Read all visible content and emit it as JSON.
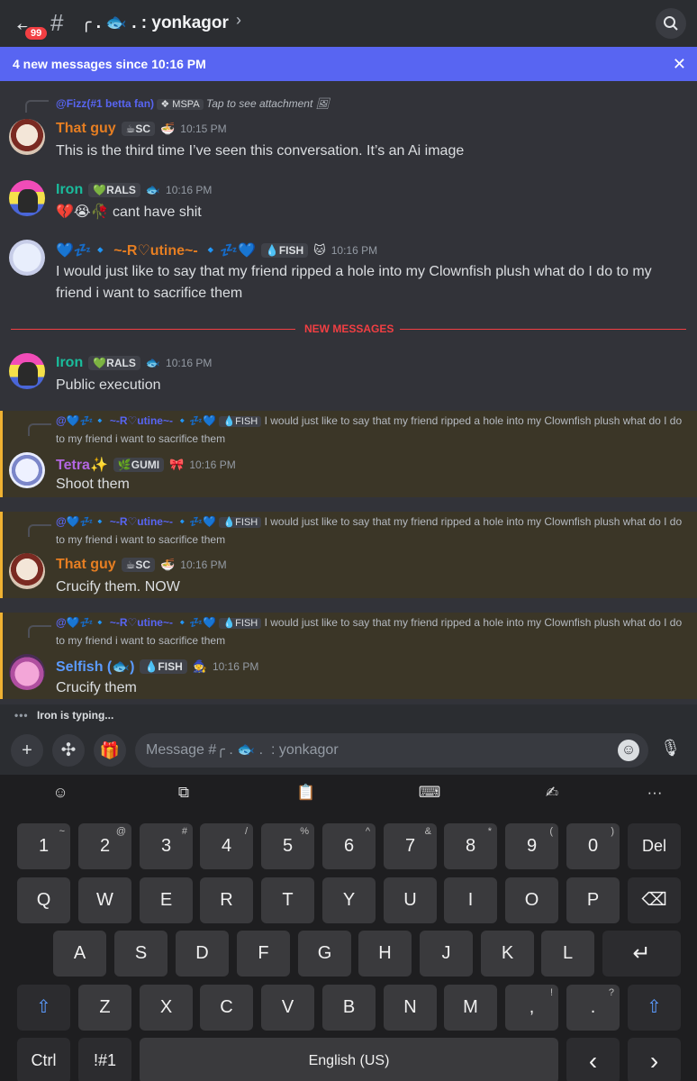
{
  "header": {
    "back_icon": "back-arrow-icon",
    "unread_badge": "99",
    "hash_symbol": "#",
    "channel_name": "╭ . 🐟 .  : yonkagor",
    "chevron": "›"
  },
  "banner": {
    "text": "4 new messages since 10:16 PM",
    "close": "✕"
  },
  "messages": [
    {
      "reply": {
        "name": "@Fizz(#1 betta fan)",
        "tag": "❖ MSPA",
        "text": "Tap to see attachment 🖼"
      },
      "author": "That guy",
      "author_color": "#e67e22",
      "tag": "☕SC",
      "deco": "🍜",
      "time": "10:15 PM",
      "content": "This is the third time I’ve seen this conversation. It’s an Ai image"
    },
    {
      "author": "Iron",
      "author_color": "#1abc9c",
      "tag": "💚RALS",
      "deco": "🐟",
      "time": "10:16 PM",
      "content": "💔😭🥀  cant have shit"
    },
    {
      "author": "💙💤🔹 ~-R♡utine~- 🔹💤💙",
      "author_color": "#e67e22",
      "tag": "💧FISH",
      "deco": "🐱",
      "time": "10:16 PM",
      "content": "I would just like to say that my friend ripped a hole into my Clownfish plush what do I do to my friend i want to sacrifice them"
    },
    {
      "author": "Iron",
      "author_color": "#1abc9c",
      "tag": "💚RALS",
      "deco": "🐟",
      "time": "10:16 PM",
      "content": "Public execution"
    },
    {
      "reply": {
        "name": "@💙💤🔹 ~-R♡utine~- 🔹💤💙",
        "tag": "💧FISH",
        "text": "I would just like to say that my friend ripped a hole into my Clownfish plush what do I do to my friend i want to sacrifice them"
      },
      "author": "Tetra✨",
      "author_color": "#b266e0",
      "tag": "🌿GUMI",
      "deco": "🎀",
      "time": "10:16 PM",
      "content": "Shoot them"
    },
    {
      "reply": {
        "name": "@💙💤🔹 ~-R♡utine~- 🔹💤💙",
        "tag": "💧FISH",
        "text": "I would just like to say that my friend ripped a hole into my Clownfish plush what do I do to my friend i want to sacrifice them"
      },
      "author": "That guy",
      "author_color": "#e67e22",
      "tag": "☕SC",
      "deco": "🍜",
      "time": "10:16 PM",
      "content": "Crucify them. NOW"
    },
    {
      "reply": {
        "name": "@💙💤🔹 ~-R♡utine~- 🔹💤💙",
        "tag": "💧FISH",
        "text": "I would just like to say that my friend ripped a hole into my Clownfish plush what do I do to my friend i want to sacrifice them"
      },
      "author": "Selfish (🐟)",
      "author_color": "#5b9bff",
      "tag": "💧FISH",
      "deco": "🧙",
      "time": "10:16 PM",
      "content": "Crucify them"
    }
  ],
  "divider_label": "NEW MESSAGES",
  "typing": {
    "dots": "•••",
    "text": "Iron is typing..."
  },
  "composer": {
    "placeholder": "Message #╭ . 🐟 .  : yonkagor",
    "plus": "+",
    "apps": "✣",
    "gift": "🎁",
    "emoji": "☺",
    "mic": "🎙"
  },
  "keyboard": {
    "toolbar": [
      "☺",
      "⧉",
      "📋",
      "⌨",
      "✍",
      "···"
    ],
    "row1": [
      [
        "1",
        "~"
      ],
      [
        "2",
        "@"
      ],
      [
        "3",
        "#"
      ],
      [
        "4",
        "/"
      ],
      [
        "5",
        "%"
      ],
      [
        "6",
        "^"
      ],
      [
        "7",
        "&"
      ],
      [
        "8",
        "*"
      ],
      [
        "9",
        "("
      ],
      [
        "0",
        ")"
      ]
    ],
    "del": "Del",
    "row2": [
      "Q",
      "W",
      "E",
      "R",
      "T",
      "Y",
      "U",
      "I",
      "O",
      "P"
    ],
    "backspace": "⌫",
    "row3": [
      "A",
      "S",
      "D",
      "F",
      "G",
      "H",
      "J",
      "K",
      "L"
    ],
    "enter": "↵",
    "row4": [
      "Z",
      "X",
      "C",
      "V",
      "B",
      "N",
      "M"
    ],
    "comma": [
      ",",
      "!"
    ],
    "period": [
      ".",
      "?"
    ],
    "shift": "⇧",
    "ctrl": "Ctrl",
    "symbols": "!#1",
    "space": "English (US)",
    "left": "‹",
    "right": "›"
  }
}
